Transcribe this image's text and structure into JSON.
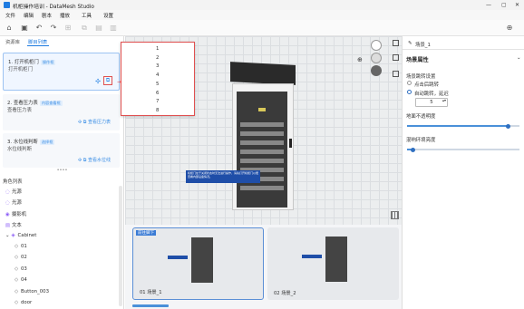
{
  "window": {
    "title": "机柜操作培训 - DataMesh Studio",
    "minimize": "—",
    "maximize": "▢",
    "close": "✕"
  },
  "menu": [
    "文件",
    "编辑",
    "剧本",
    "播放",
    "工具",
    "设置"
  ],
  "left": {
    "tabs": [
      "资源库",
      "脚目列表"
    ],
    "steps": [
      {
        "title": "1. 打开机柜门",
        "badge": "操作框",
        "desc": "打开机柜门",
        "action": "",
        "icons": [
          "move-icon",
          "copy-icon"
        ]
      },
      {
        "title": "2. 查看压力表",
        "badge": "内容查看框",
        "desc": "查看压力表",
        "action": "查看压力表"
      },
      {
        "title": "3. 水位线判断",
        "badge": "选择框",
        "desc": "水位线判断",
        "action": "查看水位线"
      }
    ],
    "splitter": "••••",
    "tree_title": "角色列表",
    "tree": [
      {
        "label": "光源",
        "icon": "bulb-icon",
        "indent": 0
      },
      {
        "label": "光源",
        "icon": "bulb-icon",
        "indent": 0
      },
      {
        "label": "摄影机",
        "icon": "camera-icon",
        "indent": 0
      },
      {
        "label": "文本",
        "icon": "text-icon",
        "indent": 0
      },
      {
        "label": "Cabinet",
        "icon": "model-icon",
        "indent": 0,
        "expand": "⌄"
      },
      {
        "label": "01",
        "icon": "cube-icon",
        "indent": 1
      },
      {
        "label": "02",
        "icon": "cube-icon",
        "indent": 1
      },
      {
        "label": "03",
        "icon": "cube-icon",
        "indent": 1
      },
      {
        "label": "04",
        "icon": "cube-icon",
        "indent": 1
      },
      {
        "label": "Button_003",
        "icon": "cube-icon",
        "indent": 1
      },
      {
        "label": "door",
        "icon": "cube-icon",
        "indent": 1
      }
    ]
  },
  "popup": {
    "numbers": [
      "1",
      "2",
      "3",
      "4",
      "5",
      "6",
      "7",
      "8"
    ]
  },
  "viewport": {
    "banner_text": "机柜门处于关闭状态时无法进行操作，请先打开机柜门以便查看内部设备情况。",
    "nav_badge": "⊕"
  },
  "right": {
    "scene_label": "场景_1",
    "section_title": "场景属性",
    "switch_title": "场景跳转设置",
    "radio1": "点击后跳转",
    "radio2": "自动跳转，延迟",
    "delay_value": "5",
    "opacity_label": "地面不透明度",
    "opacity_value": 0.9,
    "env_label": "混响环境亮度",
    "env_value": 0.05
  },
  "bottom": {
    "scenes": [
      {
        "label": "01  场景_1",
        "tag": "前往脚下",
        "active": true
      },
      {
        "label": "02  场景_2",
        "tag": "",
        "active": false
      }
    ]
  }
}
